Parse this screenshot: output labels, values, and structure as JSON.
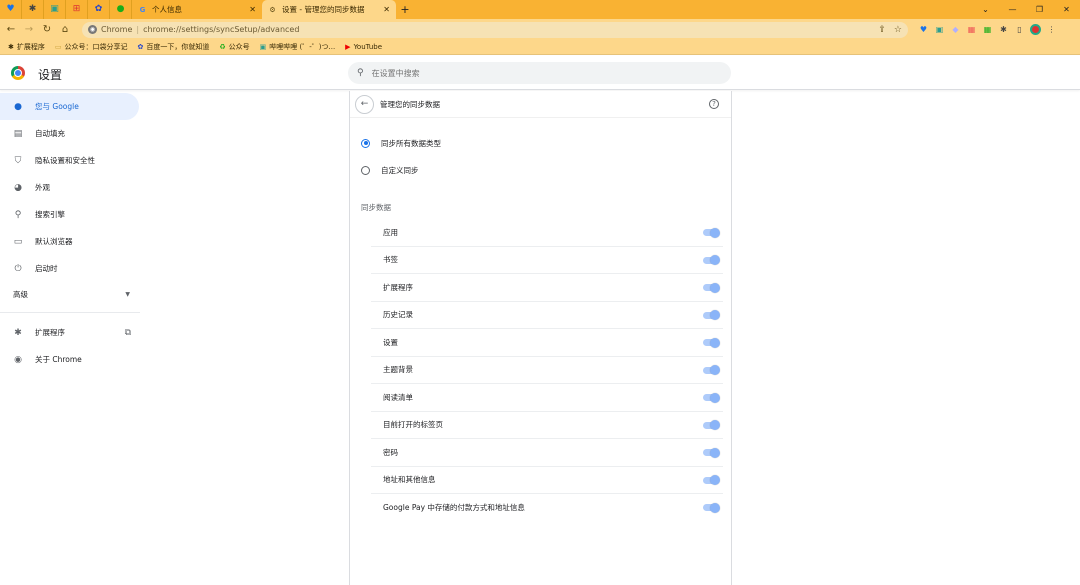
{
  "tabs": {
    "pinned_icons": [
      "location-icon",
      "puzzle-icon",
      "cat-icon",
      "grid-icon",
      "app-icon",
      "chat-icon"
    ],
    "inactive": {
      "title": "个人信息"
    },
    "active": {
      "title": "设置 - 管理您的同步数据"
    }
  },
  "omnibox": {
    "site": "Chrome",
    "separator": "|",
    "url": "chrome://settings/syncSetup/advanced"
  },
  "bookmarks": [
    {
      "label": "扩展程序",
      "icon": "puzzle-icon"
    },
    {
      "label": "公众号：口袋分享记",
      "icon": "page-icon"
    },
    {
      "label": "百度一下，你就知道",
      "icon": "baidu-icon"
    },
    {
      "label": "公众号",
      "icon": "recycle-icon"
    },
    {
      "label": "哔哩哔哩 (゜-゜)つ...",
      "icon": "bilibili-icon"
    },
    {
      "label": "YouTube",
      "icon": "youtube-icon"
    }
  ],
  "header": {
    "title": "设置",
    "search_placeholder": "在设置中搜索"
  },
  "sidebar": {
    "items": [
      {
        "label": "您与 Google",
        "icon": "person-icon"
      },
      {
        "label": "自动填充",
        "icon": "clipboard-icon"
      },
      {
        "label": "隐私设置和安全性",
        "icon": "shield-icon"
      },
      {
        "label": "外观",
        "icon": "palette-icon"
      },
      {
        "label": "搜索引擎",
        "icon": "search-icon"
      },
      {
        "label": "默认浏览器",
        "icon": "browser-icon"
      },
      {
        "label": "启动时",
        "icon": "power-icon"
      }
    ],
    "advanced": "高级",
    "extensions": "扩展程序",
    "about": "关于 Chrome"
  },
  "card": {
    "title": "管理您的同步数据",
    "option_sync_all": "同步所有数据类型",
    "option_custom": "自定义同步",
    "section_label": "同步数据",
    "items": [
      {
        "label": "应用"
      },
      {
        "label": "书签"
      },
      {
        "label": "扩展程序"
      },
      {
        "label": "历史记录"
      },
      {
        "label": "设置"
      },
      {
        "label": "主题背景"
      },
      {
        "label": "阅读清单"
      },
      {
        "label": "目前打开的标签页"
      },
      {
        "label": "密码"
      },
      {
        "label": "地址和其他信息"
      },
      {
        "label": "Google Pay 中存储的付款方式和地址信息"
      }
    ]
  },
  "colors": {
    "tabstrip": "#f9b233",
    "toolbar": "#fdd78a",
    "accent": "#1a73e8",
    "toggle_track": "#aecbfa",
    "toggle_knob": "#8ab4f8"
  }
}
